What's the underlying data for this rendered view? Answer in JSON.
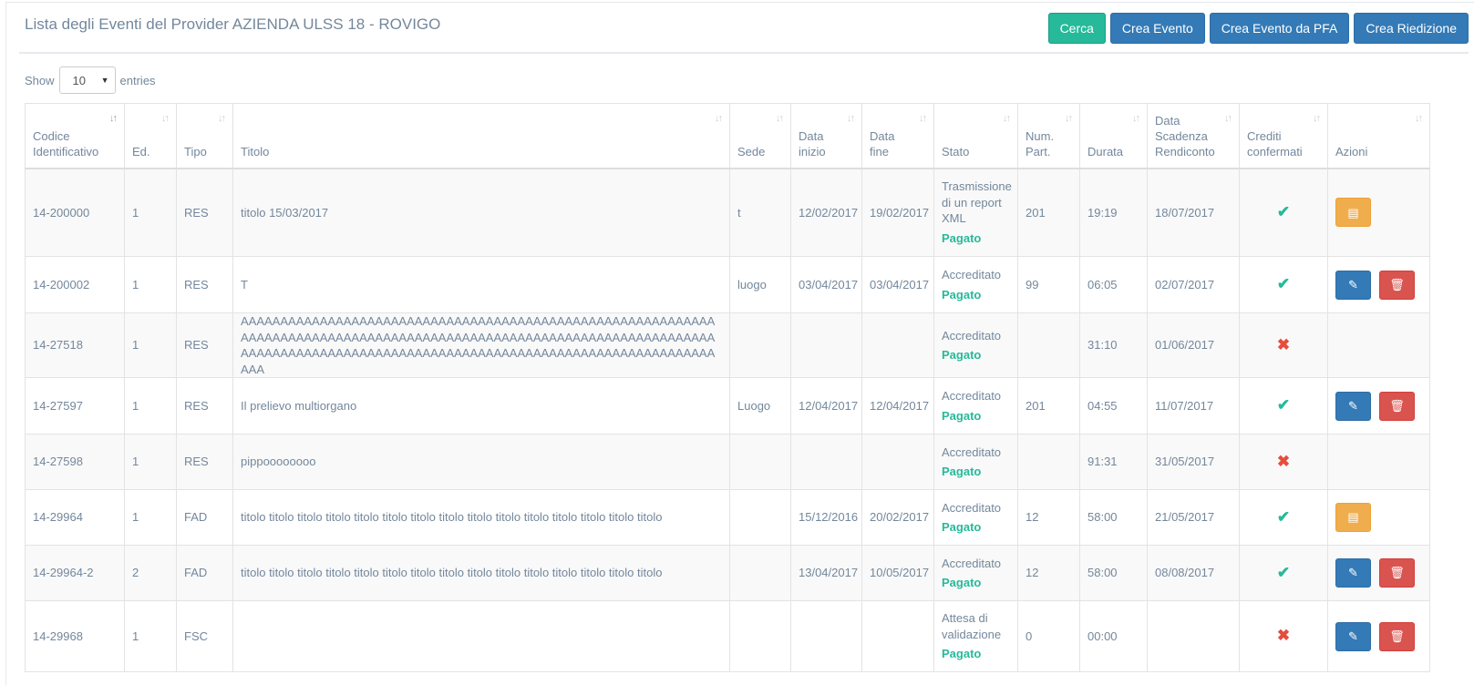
{
  "header": {
    "title": "Lista degli Eventi del Provider AZIENDA ULSS 18 - ROVIGO",
    "buttons": {
      "cerca": "Cerca",
      "crea_evento": "Crea Evento",
      "crea_evento_pfa": "Crea Evento da PFA",
      "crea_riedizione": "Crea Riedizione"
    },
    "colors": {
      "success": "#26b99a",
      "primary": "#337ab7",
      "warning": "#f0ad4e",
      "danger": "#d9534f"
    }
  },
  "length": {
    "show": "Show",
    "value": "10",
    "entries": "entries"
  },
  "table": {
    "columns": [
      {
        "l1": "Codice",
        "l2": "Identificativo",
        "l3": ""
      },
      {
        "l1": "Ed.",
        "l2": "",
        "l3": ""
      },
      {
        "l1": "Tipo",
        "l2": "",
        "l3": ""
      },
      {
        "l1": "Titolo",
        "l2": "",
        "l3": ""
      },
      {
        "l1": "Sede",
        "l2": "",
        "l3": ""
      },
      {
        "l1": "Data",
        "l2": "inizio",
        "l3": ""
      },
      {
        "l1": "Data",
        "l2": "fine",
        "l3": ""
      },
      {
        "l1": "Stato",
        "l2": "",
        "l3": ""
      },
      {
        "l1": "Num.",
        "l2": "Part.",
        "l3": ""
      },
      {
        "l1": "Durata",
        "l2": "",
        "l3": ""
      },
      {
        "l1": "Data",
        "l2": "Scadenza",
        "l3": "Rendiconto"
      },
      {
        "l1": "Crediti",
        "l2": "confermati",
        "l3": ""
      },
      {
        "l1": "Azioni",
        "l2": "",
        "l3": ""
      }
    ],
    "rows": [
      {
        "codice": "14-200000",
        "ed": "1",
        "tipo": "RES",
        "titolo": "titolo 15/03/2017",
        "sede": "t",
        "inizio": "12/02/2017",
        "fine": "19/02/2017",
        "stato": "Trasmissione di un report XML",
        "pagamento": "Pagato",
        "part": "201",
        "durata": "19:19",
        "scadenza": "18/07/2017",
        "crediti": "ok",
        "azioni": "report"
      },
      {
        "codice": "14-200002",
        "ed": "1",
        "tipo": "RES",
        "titolo": "T",
        "sede": "luogo",
        "inizio": "03/04/2017",
        "fine": "03/04/2017",
        "stato": "Accreditato",
        "pagamento": "Pagato",
        "part": "99",
        "durata": "06:05",
        "scadenza": "02/07/2017",
        "crediti": "ok",
        "azioni": "edit-delete"
      },
      {
        "codice": "14-27518",
        "ed": "1",
        "tipo": "RES",
        "titolo": "AAAAAAAAAAAAAAAAAAAAAAAAAAAAAAAAAAAAAAAAAAAAAAAAAAAAAAAAAAAAAAAAAAAAAAAAAAAAAAAAAAAAAAAAAAAAAAAAAAAAAAAAAAAAAAAAAAAAAAAAAAAAAAAAAAAAAAAAAAAAAAAAAAAAAAAAAAAAAAAAAAAAAAAAAAAAAAAAAAAAAAA",
        "sede": "",
        "inizio": "",
        "fine": "",
        "stato": "Accreditato",
        "pagamento": "Pagato",
        "part": "",
        "durata": "31:10",
        "scadenza": "01/06/2017",
        "crediti": "no",
        "azioni": ""
      },
      {
        "codice": "14-27597",
        "ed": "1",
        "tipo": "RES",
        "titolo": "Il prelievo multiorgano",
        "sede": "Luogo",
        "inizio": "12/04/2017",
        "fine": "12/04/2017",
        "stato": "Accreditato",
        "pagamento": "Pagato",
        "part": "201",
        "durata": "04:55",
        "scadenza": "11/07/2017",
        "crediti": "ok",
        "azioni": "edit-delete"
      },
      {
        "codice": "14-27598",
        "ed": "1",
        "tipo": "RES",
        "titolo": "pippoooooooo",
        "sede": "",
        "inizio": "",
        "fine": "",
        "stato": "Accreditato",
        "pagamento": "Pagato",
        "part": "",
        "durata": "91:31",
        "scadenza": "31/05/2017",
        "crediti": "no",
        "azioni": ""
      },
      {
        "codice": "14-29964",
        "ed": "1",
        "tipo": "FAD",
        "titolo": "titolo titolo titolo titolo titolo titolo titolo titolo titolo titolo titolo titolo titolo titolo titolo",
        "sede": "",
        "inizio": "15/12/2016",
        "fine": "20/02/2017",
        "stato": "Accreditato",
        "pagamento": "Pagato",
        "part": "12",
        "durata": "58:00",
        "scadenza": "21/05/2017",
        "crediti": "ok",
        "azioni": "report"
      },
      {
        "codice": "14-29964-2",
        "ed": "2",
        "tipo": "FAD",
        "titolo": "titolo titolo titolo titolo titolo titolo titolo titolo titolo titolo titolo titolo titolo titolo titolo",
        "sede": "",
        "inizio": "13/04/2017",
        "fine": "10/05/2017",
        "stato": "Accreditato",
        "pagamento": "Pagato",
        "part": "12",
        "durata": "58:00",
        "scadenza": "08/08/2017",
        "crediti": "ok",
        "azioni": "edit-delete"
      },
      {
        "codice": "14-29968",
        "ed": "1",
        "tipo": "FSC",
        "titolo": "",
        "sede": "",
        "inizio": "",
        "fine": "",
        "stato": "Attesa di validazione",
        "pagamento": "Pagato",
        "part": "0",
        "durata": "00:00",
        "scadenza": "",
        "crediti": "no",
        "azioni": "edit-delete"
      }
    ]
  }
}
